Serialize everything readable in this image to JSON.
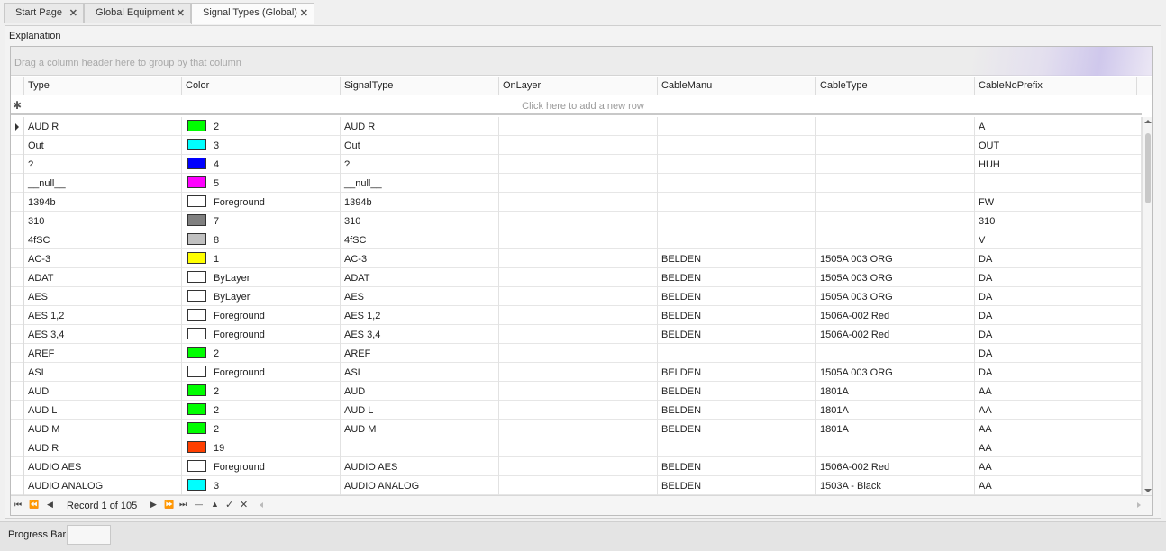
{
  "tabs": [
    {
      "label": "Start Page",
      "active": false
    },
    {
      "label": "Global Equipment",
      "active": false
    },
    {
      "label": "Signal Types (Global)",
      "active": true
    }
  ],
  "panel": {
    "title": "Explanation",
    "group_hint": "Drag a column header here to group by that column",
    "new_row_hint": "Click here to add a new row"
  },
  "columns": [
    "Type",
    "Color",
    "SignalType",
    "OnLayer",
    "CableManu",
    "CableType",
    "CableNoPrefix"
  ],
  "rows": [
    {
      "type": "AUD R",
      "color_hex": "#00ff00",
      "color": "2",
      "signal_type": "AUD R",
      "on_layer": "",
      "cable_manu": "",
      "cable_type": "",
      "prefix": "A",
      "current": true
    },
    {
      "type": "Out",
      "color_hex": "#00ffff",
      "color": "3",
      "signal_type": "Out",
      "on_layer": "",
      "cable_manu": "",
      "cable_type": "",
      "prefix": "OUT"
    },
    {
      "type": "?",
      "color_hex": "#0000ff",
      "color": "4",
      "signal_type": "?",
      "on_layer": "",
      "cable_manu": "",
      "cable_type": "",
      "prefix": "HUH"
    },
    {
      "type": "__null__",
      "color_hex": "#ff00ff",
      "color": "5",
      "signal_type": "__null__",
      "on_layer": "",
      "cable_manu": "",
      "cable_type": "",
      "prefix": ""
    },
    {
      "type": "1394b",
      "color_hex": "#ffffff",
      "color": "Foreground",
      "signal_type": "1394b",
      "on_layer": "",
      "cable_manu": "",
      "cable_type": "",
      "prefix": "FW"
    },
    {
      "type": "310",
      "color_hex": "#808080",
      "color": "7",
      "signal_type": "310",
      "on_layer": "",
      "cable_manu": "",
      "cable_type": "",
      "prefix": "310"
    },
    {
      "type": "4fSC",
      "color_hex": "#c0c0c0",
      "color": "8",
      "signal_type": "4fSC",
      "on_layer": "",
      "cable_manu": "",
      "cable_type": "",
      "prefix": "V"
    },
    {
      "type": "AC-3",
      "color_hex": "#ffff00",
      "color": "1",
      "signal_type": "AC-3",
      "on_layer": "",
      "cable_manu": "BELDEN",
      "cable_type": "1505A 003 ORG",
      "prefix": "DA"
    },
    {
      "type": "ADAT",
      "color_hex": "#ffffff",
      "color": "ByLayer",
      "signal_type": "ADAT",
      "on_layer": "",
      "cable_manu": "BELDEN",
      "cable_type": "1505A 003 ORG",
      "prefix": "DA"
    },
    {
      "type": "AES",
      "color_hex": "#ffffff",
      "color": "ByLayer",
      "signal_type": "AES",
      "on_layer": "",
      "cable_manu": "BELDEN",
      "cable_type": "1505A 003 ORG",
      "prefix": "DA"
    },
    {
      "type": "AES 1,2",
      "color_hex": "#ffffff",
      "color": "Foreground",
      "signal_type": "AES 1,2",
      "on_layer": "",
      "cable_manu": "BELDEN",
      "cable_type": "1506A-002 Red",
      "prefix": "DA"
    },
    {
      "type": "AES 3,4",
      "color_hex": "#ffffff",
      "color": "Foreground",
      "signal_type": "AES 3,4",
      "on_layer": "",
      "cable_manu": "BELDEN",
      "cable_type": "1506A-002 Red",
      "prefix": "DA"
    },
    {
      "type": "AREF",
      "color_hex": "#00ff00",
      "color": "2",
      "signal_type": "AREF",
      "on_layer": "",
      "cable_manu": "",
      "cable_type": "",
      "prefix": "DA"
    },
    {
      "type": "ASI",
      "color_hex": "#ffffff",
      "color": "Foreground",
      "signal_type": "ASI",
      "on_layer": "",
      "cable_manu": "BELDEN",
      "cable_type": "1505A 003 ORG",
      "prefix": "DA"
    },
    {
      "type": "AUD",
      "color_hex": "#00ff00",
      "color": "2",
      "signal_type": "AUD",
      "on_layer": "",
      "cable_manu": "BELDEN",
      "cable_type": "1801A",
      "prefix": "AA"
    },
    {
      "type": "AUD L",
      "color_hex": "#00ff00",
      "color": "2",
      "signal_type": "AUD L",
      "on_layer": "",
      "cable_manu": "BELDEN",
      "cable_type": "1801A",
      "prefix": "AA"
    },
    {
      "type": "AUD M",
      "color_hex": "#00ff00",
      "color": "2",
      "signal_type": "AUD M",
      "on_layer": "",
      "cable_manu": "BELDEN",
      "cable_type": "1801A",
      "prefix": "AA"
    },
    {
      "type": "AUD R",
      "color_hex": "#ff3f00",
      "color": "19",
      "signal_type": "",
      "on_layer": "",
      "cable_manu": "",
      "cable_type": "",
      "prefix": "AA"
    },
    {
      "type": "AUDIO AES",
      "color_hex": "#ffffff",
      "color": "Foreground",
      "signal_type": "AUDIO AES",
      "on_layer": "",
      "cable_manu": "BELDEN",
      "cable_type": "1506A-002 Red",
      "prefix": "AA"
    },
    {
      "type": "AUDIO ANALOG",
      "color_hex": "#00ffff",
      "color": "3",
      "signal_type": "AUDIO ANALOG",
      "on_layer": "",
      "cable_manu": "BELDEN",
      "cable_type": "1503A - Black",
      "prefix": "AA"
    }
  ],
  "navigator": {
    "record_text": "Record 1 of 105"
  },
  "status": {
    "label": "Progress Bar"
  }
}
